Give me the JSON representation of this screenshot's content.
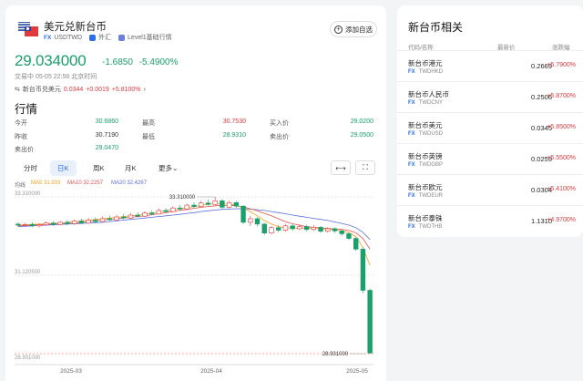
{
  "header": {
    "title": "美元兑新台币",
    "market_tag": "FX",
    "code": "USDTWD",
    "category": "外汇",
    "level": "Level1基础行情",
    "watch_label": "添加自选"
  },
  "quote": {
    "price": "29.034000",
    "change": "-1.6850",
    "change_pct": "-5.4900%",
    "time": "交易中 05-05 22:56 北京时间"
  },
  "pair": {
    "label": "新台币兑美元",
    "price": "0.0344",
    "change": "+0.0019",
    "change_pct": "+5.8100%"
  },
  "section_title": "行情",
  "stats": [
    {
      "label": "今开",
      "value": "30.6860",
      "color": "g"
    },
    {
      "label": "最高",
      "value": "30.7530",
      "color": "r"
    },
    {
      "label": "买入价",
      "value": "29.0200",
      "color": "g"
    },
    {
      "label": "昨收",
      "value": "30.7190",
      "color": "n"
    },
    {
      "label": "最低",
      "value": "28.9310",
      "color": "g"
    },
    {
      "label": "卖出价",
      "value": "29.0500",
      "color": "g"
    },
    {
      "label": "卖出价",
      "value": "29.0470",
      "color": "g"
    }
  ],
  "tabs": {
    "minute": "分时",
    "day": "日K",
    "week": "周K",
    "month": "月K",
    "more": "更多"
  },
  "ma": {
    "label": "均线",
    "ma5": "MA5 31.933",
    "ma10": "MA10 32.2257",
    "ma20": "MA20 32.4267"
  },
  "chart_data": {
    "type": "candlestick",
    "ylabels": {
      "top": "33.310000",
      "mid": "31.120500",
      "bottom": "28.931000"
    },
    "xlabels": [
      "2025-03",
      "2025-04",
      "2025-05"
    ],
    "annotations": {
      "high": "33.310000",
      "low": "28.931000"
    },
    "ylim": [
      28.931,
      33.31
    ],
    "candles": [
      [
        32.55,
        32.52,
        32.6,
        32.48
      ],
      [
        32.52,
        32.54,
        32.58,
        32.47
      ],
      [
        32.54,
        32.5,
        32.6,
        32.46
      ],
      [
        32.5,
        32.53,
        32.57,
        32.45
      ],
      [
        32.53,
        32.58,
        32.62,
        32.49
      ],
      [
        32.58,
        32.54,
        32.63,
        32.5
      ],
      [
        32.54,
        32.6,
        32.64,
        32.51
      ],
      [
        32.6,
        32.56,
        32.66,
        32.52
      ],
      [
        32.56,
        32.63,
        32.68,
        32.53
      ],
      [
        32.63,
        32.58,
        32.7,
        32.55
      ],
      [
        32.58,
        32.66,
        32.72,
        32.56
      ],
      [
        32.66,
        32.62,
        32.74,
        32.58
      ],
      [
        32.62,
        32.7,
        32.76,
        32.6
      ],
      [
        32.7,
        32.67,
        32.79,
        32.63
      ],
      [
        32.67,
        32.75,
        32.81,
        32.64
      ],
      [
        32.75,
        32.72,
        32.84,
        32.68
      ],
      [
        32.72,
        32.8,
        32.86,
        32.7
      ],
      [
        32.8,
        32.77,
        32.88,
        32.73
      ],
      [
        32.77,
        32.86,
        32.91,
        32.75
      ],
      [
        32.86,
        32.83,
        32.93,
        32.79
      ],
      [
        32.83,
        32.93,
        32.98,
        32.81
      ],
      [
        32.93,
        32.9,
        33.0,
        32.86
      ],
      [
        32.9,
        33.0,
        33.05,
        32.88
      ],
      [
        33.0,
        32.97,
        33.08,
        32.93
      ],
      [
        32.97,
        33.08,
        33.12,
        32.95
      ],
      [
        33.08,
        33.04,
        33.16,
        33.0
      ],
      [
        33.04,
        33.14,
        33.2,
        33.02
      ],
      [
        33.14,
        33.1,
        33.24,
        33.06
      ],
      [
        33.1,
        33.2,
        33.31,
        33.08
      ],
      [
        33.2,
        33.02,
        33.25,
        32.98
      ],
      [
        33.02,
        33.15,
        33.2,
        32.99
      ],
      [
        33.15,
        33.05,
        33.2,
        33.0
      ],
      [
        33.05,
        32.6,
        33.08,
        32.55
      ],
      [
        32.6,
        32.7,
        32.78,
        32.5
      ],
      [
        32.7,
        32.55,
        32.75,
        32.48
      ],
      [
        32.55,
        32.3,
        32.58,
        32.25
      ],
      [
        32.3,
        32.45,
        32.5,
        32.26
      ],
      [
        32.45,
        32.38,
        32.52,
        32.32
      ],
      [
        32.38,
        32.5,
        32.56,
        32.34
      ],
      [
        32.5,
        32.42,
        32.55,
        32.36
      ],
      [
        32.42,
        32.48,
        32.54,
        32.38
      ],
      [
        32.48,
        32.4,
        32.53,
        32.35
      ],
      [
        32.4,
        32.46,
        32.52,
        32.36
      ],
      [
        32.46,
        32.35,
        32.5,
        32.3
      ],
      [
        32.35,
        32.42,
        32.47,
        32.31
      ],
      [
        32.42,
        32.36,
        32.46,
        32.3
      ],
      [
        32.36,
        32.28,
        32.4,
        32.22
      ],
      [
        32.28,
        32.15,
        32.32,
        32.1
      ],
      [
        32.15,
        31.85,
        32.18,
        31.8
      ],
      [
        31.85,
        30.7,
        31.9,
        30.62
      ],
      [
        30.7,
        28.95,
        30.75,
        28.93
      ]
    ],
    "ma_lines": {
      "ma5": [
        32.52,
        32.53,
        32.54,
        32.55,
        32.56,
        32.57,
        32.58,
        32.6,
        32.62,
        32.64,
        32.66,
        32.68,
        32.7,
        32.72,
        32.74,
        32.76,
        32.78,
        32.8,
        32.83,
        32.86,
        32.89,
        32.92,
        32.95,
        32.98,
        33.01,
        33.04,
        33.07,
        33.1,
        33.12,
        33.12,
        33.1,
        33.08,
        33.0,
        32.9,
        32.78,
        32.65,
        32.55,
        32.48,
        32.45,
        32.44,
        32.44,
        32.44,
        32.44,
        32.42,
        32.41,
        32.39,
        32.36,
        32.31,
        32.2,
        31.9,
        31.4
      ],
      "ma10": [
        32.5,
        32.51,
        32.52,
        32.53,
        32.54,
        32.55,
        32.56,
        32.57,
        32.58,
        32.6,
        32.62,
        32.64,
        32.66,
        32.68,
        32.7,
        32.72,
        32.74,
        32.76,
        32.78,
        32.81,
        32.84,
        32.87,
        32.9,
        32.93,
        32.96,
        32.99,
        33.02,
        33.04,
        33.06,
        33.07,
        33.07,
        33.06,
        33.03,
        32.98,
        32.92,
        32.85,
        32.78,
        32.7,
        32.62,
        32.56,
        32.52,
        32.48,
        32.46,
        32.44,
        32.43,
        32.42,
        32.4,
        32.37,
        32.31,
        32.15,
        31.85
      ],
      "ma20": [
        32.48,
        32.49,
        32.5,
        32.51,
        32.52,
        32.53,
        32.54,
        32.55,
        32.56,
        32.57,
        32.58,
        32.59,
        32.6,
        32.62,
        32.64,
        32.66,
        32.68,
        32.7,
        32.72,
        32.74,
        32.76,
        32.78,
        32.8,
        32.82,
        32.85,
        32.87,
        32.9,
        32.92,
        32.94,
        32.96,
        32.97,
        32.98,
        32.98,
        32.97,
        32.95,
        32.93,
        32.9,
        32.87,
        32.84,
        32.8,
        32.77,
        32.74,
        32.71,
        32.68,
        32.65,
        32.61,
        32.57,
        32.52,
        32.45,
        32.32,
        32.12
      ]
    }
  },
  "sidebar": {
    "title": "新台币相关",
    "headers": {
      "name": "代码/名称",
      "price": "最新价",
      "change": "涨跌幅"
    },
    "items": [
      {
        "name": "新台币港元",
        "tag": "FX",
        "code": "TWDHKD",
        "price": "0.2669",
        "change": "+5.7900%"
      },
      {
        "name": "新台币人民币",
        "tag": "FX",
        "code": "TWDCNY",
        "price": "0.2506",
        "change": "+5.8700%"
      },
      {
        "name": "新台币美元",
        "tag": "FX",
        "code": "TWDUSD",
        "price": "0.0345",
        "change": "+5.8500%"
      },
      {
        "name": "新台币英镑",
        "tag": "FX",
        "code": "TWDGBP",
        "price": "0.0259",
        "change": "+5.5500%"
      },
      {
        "name": "新台币欧元",
        "tag": "FX",
        "code": "TWDEUR",
        "price": "0.0304",
        "change": "+5.4100%"
      },
      {
        "name": "新台币泰铢",
        "tag": "FX",
        "code": "TWDTHB",
        "price": "1.1310",
        "change": "+4.9700%"
      }
    ]
  },
  "colors": {
    "up": "#e0393e",
    "down": "#1aa06d",
    "ma5": "#f0a020",
    "ma10": "#e05050",
    "ma20": "#5a6fd8",
    "accent": "#2b6de6"
  }
}
